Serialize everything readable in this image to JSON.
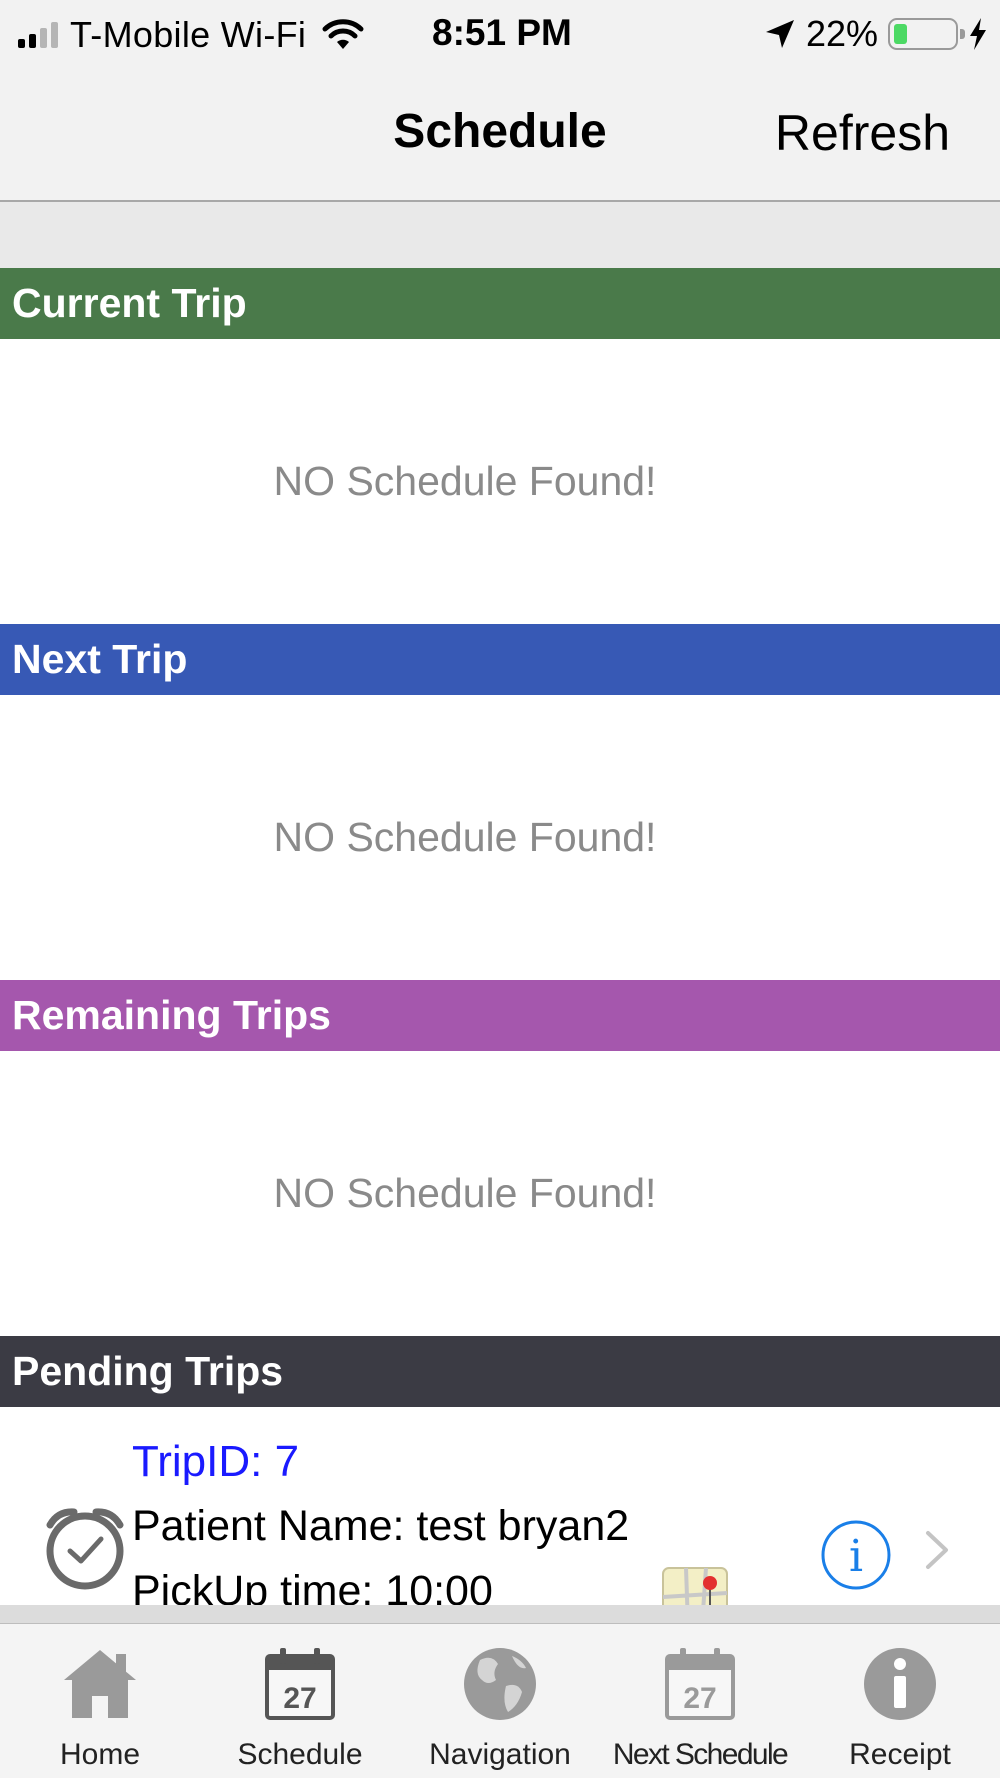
{
  "status_bar": {
    "carrier": "T-Mobile Wi-Fi",
    "time": "8:51 PM",
    "battery_percent": "22%",
    "battery_level": 0.22
  },
  "nav": {
    "title": "Schedule",
    "refresh_label": "Refresh"
  },
  "sections": {
    "current": {
      "title": "Current Trip",
      "empty_text": "NO Schedule Found!",
      "color": "#4a7a4a"
    },
    "next": {
      "title": "Next Trip",
      "empty_text": "NO Schedule Found!",
      "color": "#3759b5"
    },
    "remaining": {
      "title": "Remaining Trips",
      "empty_text": "NO Schedule Found!",
      "color": "#a557ad"
    },
    "pending": {
      "title": "Pending Trips",
      "color": "#3b3b44"
    }
  },
  "pending_trips": [
    {
      "trip_id": "TripID: 7",
      "patient": "Patient Name: test bryan2",
      "pickup": "PickUp time: 10:00"
    }
  ],
  "tabs": [
    {
      "label": "Home",
      "icon": "home-icon"
    },
    {
      "label": "Schedule",
      "icon": "calendar-icon",
      "calendar_day": "27"
    },
    {
      "label": "Navigation",
      "icon": "globe-icon"
    },
    {
      "label": "Next Schedule",
      "icon": "calendar-icon",
      "calendar_day": "27"
    },
    {
      "label": "Receipt",
      "icon": "info-icon"
    }
  ],
  "colors": {
    "link_blue": "#1a1aff",
    "info_blue": "#1a7fe8",
    "active_tab_icon": "#555555",
    "inactive_tab_icon": "#9a9a9a"
  }
}
